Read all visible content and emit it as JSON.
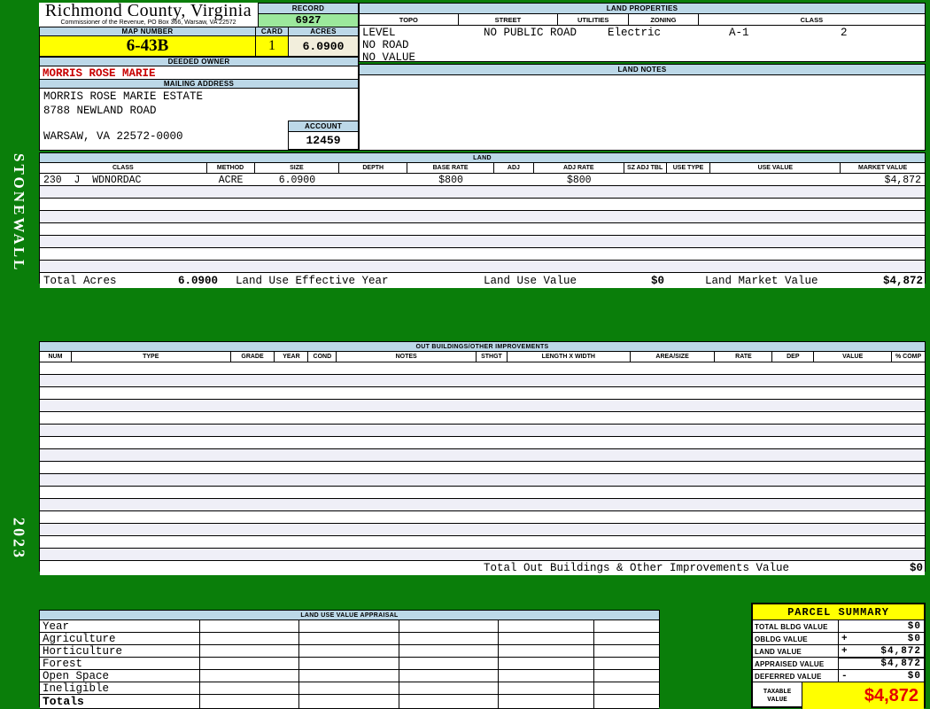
{
  "page": {
    "district": "STONEWALL",
    "year": "2023"
  },
  "header": {
    "county": "Richmond County, Virginia",
    "commissioner": "Commissioner of the Revenue, PO Box 366, Warsaw, VA 22572",
    "record_label": "RECORD",
    "record_value": "6927",
    "map_number_label": "MAP NUMBER",
    "map_number_value": "6-43B",
    "card_label": "CARD",
    "card_value": "1",
    "acres_label": "ACRES",
    "acres_value": "6.0900"
  },
  "owner": {
    "deeded_owner_label": "DEEDED OWNER",
    "deeded_owner": "MORRIS ROSE MARIE",
    "mailing_address_label": "MAILING ADDRESS",
    "address_lines": [
      "MORRIS ROSE MARIE ESTATE",
      "8788 NEWLAND ROAD",
      "WARSAW, VA 22572-0000"
    ],
    "account_label": "ACCOUNT",
    "account_value": "12459"
  },
  "land_properties": {
    "title": "LAND PROPERTIES",
    "columns": [
      "TOPO",
      "STREET",
      "UTILITIES",
      "ZONING",
      "CLASS"
    ],
    "topo_lines": [
      "LEVEL",
      "NO ROAD",
      "NO VALUE"
    ],
    "street": "NO PUBLIC ROAD",
    "utilities": "Electric",
    "zoning": "A-1",
    "class": "2"
  },
  "land_notes": {
    "title": "LAND NOTES"
  },
  "land": {
    "title": "LAND",
    "columns": [
      "CLASS",
      "METHOD",
      "SIZE",
      "DEPTH",
      "BASE RATE",
      "ADJ",
      "ADJ RATE",
      "SZ ADJ TBL",
      "USE TYPE",
      "USE VALUE",
      "MARKET VALUE"
    ],
    "rows": [
      {
        "class": "230  J  WDNORDAC",
        "method": "ACRE",
        "size": "6.0900",
        "depth": "",
        "base_rate": "$800",
        "adj": "",
        "adj_rate": "$800",
        "sz_adj_tbl": "",
        "use_type": "",
        "use_value": "",
        "market_value": "$4,872"
      }
    ],
    "empty_row_count": 7,
    "totals": {
      "total_acres_label": "Total Acres",
      "total_acres": "6.0900",
      "effective_year_label": "Land Use Effective Year",
      "use_value_label": "Land Use Value",
      "use_value": "$0",
      "market_value_label": "Land Market Value",
      "market_value": "$4,872"
    }
  },
  "out_buildings": {
    "title": "OUT BUILDINGS/OTHER IMPROVEMENTS",
    "columns": [
      "NUM",
      "TYPE",
      "GRADE",
      "YEAR",
      "COND",
      "NOTES",
      "STHGT",
      "LENGTH X WIDTH",
      "AREA/SIZE",
      "RATE",
      "DEP",
      "VALUE",
      "% COMP"
    ],
    "empty_row_count": 16,
    "total_label": "Total Out Buildings & Other Improvements Value",
    "total_value": "$0"
  },
  "land_use_appraisal": {
    "title": "LAND USE VALUE APPRAISAL",
    "row_labels": [
      "Year",
      "Agriculture",
      "Horticulture",
      "Forest",
      "Open Space",
      "Ineligible",
      "Totals"
    ],
    "value_column_count": 5
  },
  "parcel_summary": {
    "title": "PARCEL SUMMARY",
    "rows": [
      {
        "label": "TOTAL BLDG VALUE",
        "op": "",
        "value": "$0"
      },
      {
        "label": "OBLDG VALUE",
        "op": "+",
        "value": "$0"
      },
      {
        "label": "LAND VALUE",
        "op": "+",
        "value": "$4,872"
      },
      {
        "label": "APPRAISED VALUE",
        "op": "",
        "value": "$4,872"
      },
      {
        "label": "DEFERRED VALUE",
        "op": "-",
        "value": "$0"
      }
    ],
    "taxable_label": "TAXABLE\nVALUE",
    "taxable_value": "$4,872"
  },
  "colors": {
    "page_green": "#0a7e0a",
    "band_blue": "#BCD8E8",
    "record_green": "#9CE89C",
    "highlight_yellow": "#FFFF00",
    "acres_cream": "#F2EEDC",
    "owner_red": "#C80000",
    "taxable_red": "#E50000",
    "row_stripe": "#EFEFF7"
  }
}
